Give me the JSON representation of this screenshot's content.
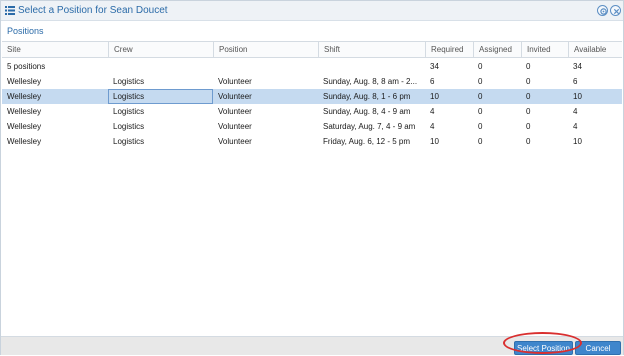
{
  "window": {
    "title": "Select a Position for Sean Doucet",
    "icons": {
      "title": "list-icon",
      "settings": "gear-icon",
      "close": "close-icon"
    }
  },
  "section": {
    "title": "Positions"
  },
  "grid": {
    "columns": [
      "Site",
      "Crew",
      "Position",
      "Shift",
      "Required",
      "Assigned",
      "Invited",
      "Available"
    ],
    "summary": {
      "site": "5 positions",
      "required": "34",
      "assigned": "0",
      "invited": "0",
      "available": "34"
    },
    "rows": [
      {
        "site": "Wellesley",
        "crew": "Logistics",
        "position": "Volunteer",
        "shift": "Sunday, Aug. 8, 8 am - 2...",
        "required": "6",
        "assigned": "0",
        "invited": "0",
        "available": "6"
      },
      {
        "site": "Wellesley",
        "crew": "Logistics",
        "position": "Volunteer",
        "shift": "Sunday, Aug. 8, 1 - 6 pm",
        "required": "10",
        "assigned": "0",
        "invited": "0",
        "available": "10"
      },
      {
        "site": "Wellesley",
        "crew": "Logistics",
        "position": "Volunteer",
        "shift": "Sunday, Aug. 8, 4 - 9 am",
        "required": "4",
        "assigned": "0",
        "invited": "0",
        "available": "4"
      },
      {
        "site": "Wellesley",
        "crew": "Logistics",
        "position": "Volunteer",
        "shift": "Saturday, Aug. 7, 4 - 9 am",
        "required": "4",
        "assigned": "0",
        "invited": "0",
        "available": "4"
      },
      {
        "site": "Wellesley",
        "crew": "Logistics",
        "position": "Volunteer",
        "shift": "Friday, Aug. 6, 12 - 5 pm",
        "required": "10",
        "assigned": "0",
        "invited": "0",
        "available": "10"
      }
    ],
    "selected_row": 1
  },
  "footer": {
    "select_label": "Select Position",
    "cancel_label": "Cancel"
  },
  "colors": {
    "accent": "#2b6ba8",
    "button": "#3f86cc",
    "selection": "#c5daf0",
    "annotation_ring": "#d92f2f"
  }
}
